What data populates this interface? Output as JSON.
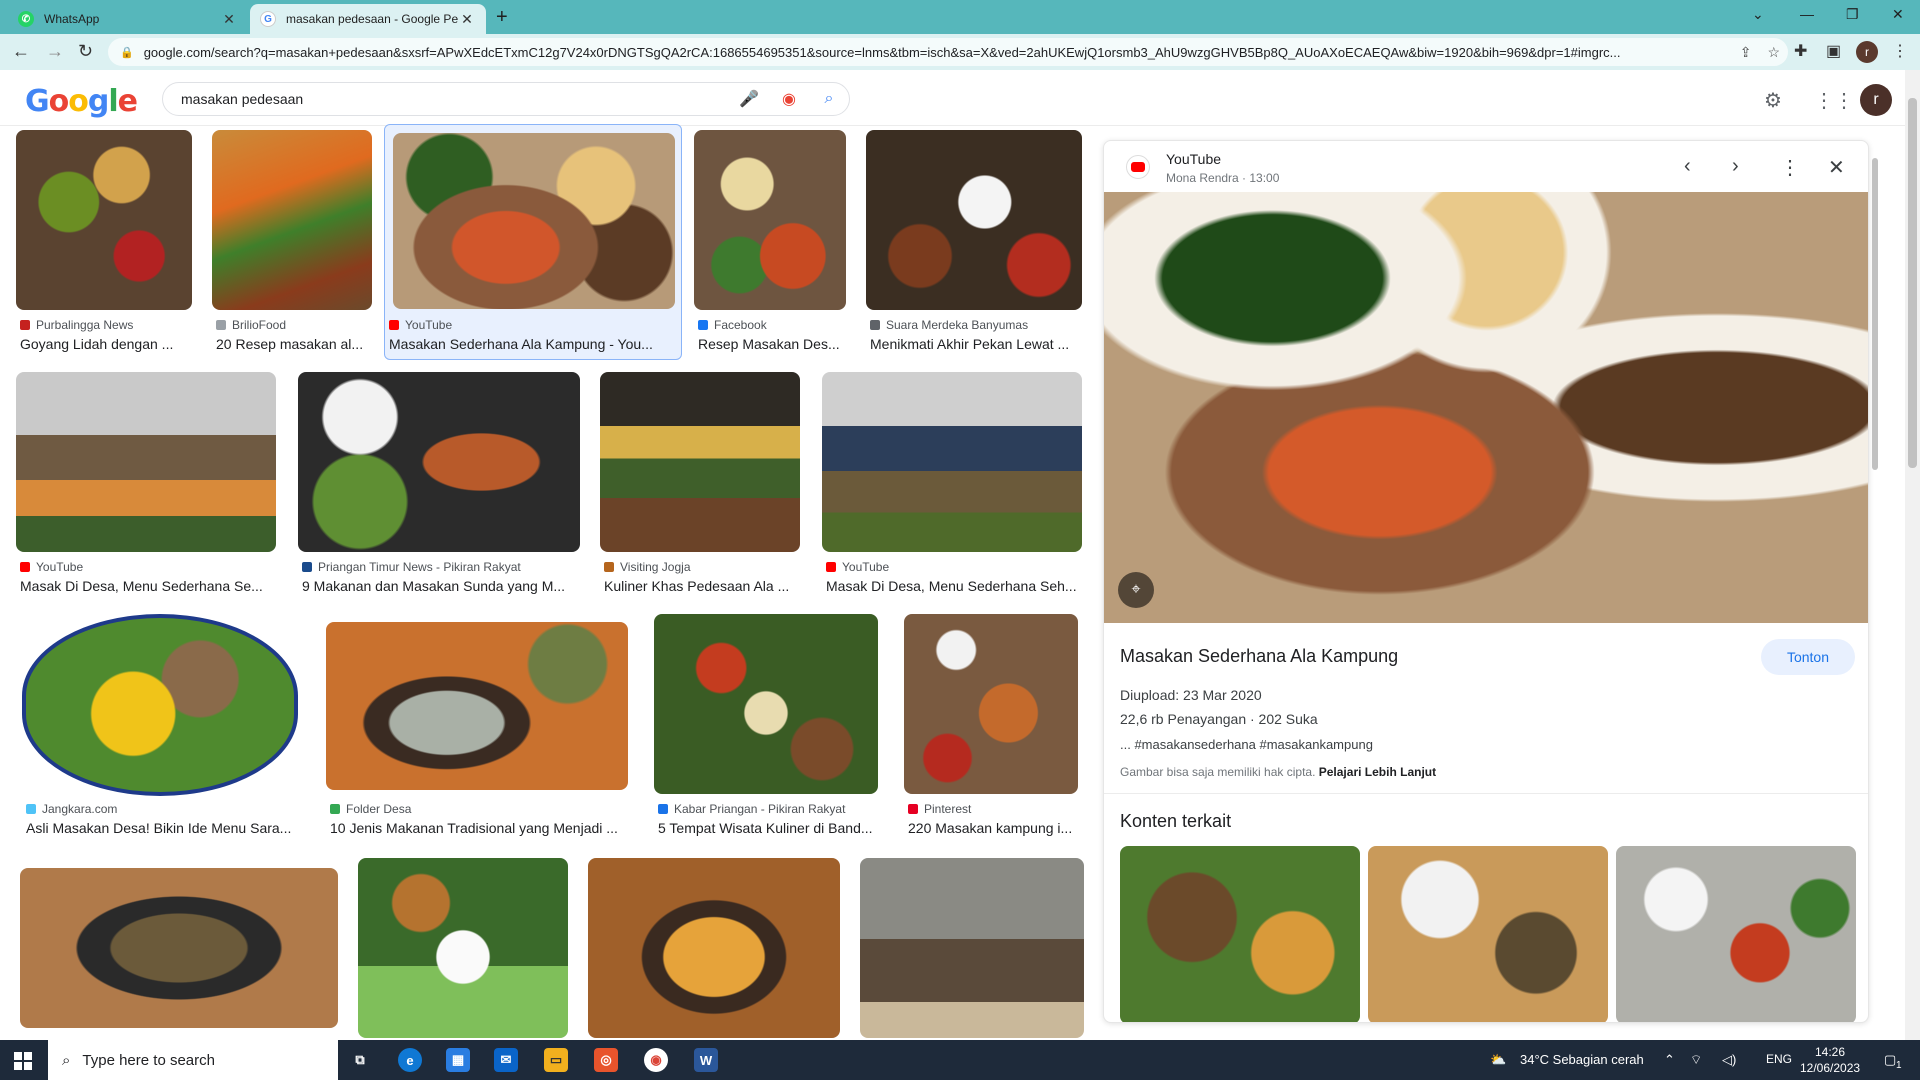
{
  "browser": {
    "tabs": [
      {
        "title": "WhatsApp",
        "icon": "whatsapp-icon",
        "active": false
      },
      {
        "title": "masakan pedesaan - Google Pen",
        "icon": "google-icon",
        "active": true
      }
    ],
    "url": "google.com/search?q=masakan+pedesaan&sxsrf=APwXEdcETxmC12g7V24x0rDNGTSgQA2rCA:1686554695351&source=lnms&tbm=isch&sa=X&ved=2ahUKEwjQ1orsmb3_AhU9wzgGHVB5Bp8Q_AUoAXoECAEQAw&biw=1920&bih=969&dpr=1#imgrc...",
    "profile_initial": "r"
  },
  "google": {
    "logo": "Google",
    "query": "masakan pedesaan",
    "avatar_initial": "r"
  },
  "results": [
    {
      "source": "Purbalingga News",
      "title": "Goyang Lidah dengan ...",
      "src_color": "#c5221f"
    },
    {
      "source": "BrilioFood",
      "title": "20 Resep masakan al...",
      "src_color": "#9aa0a6"
    },
    {
      "source": "YouTube",
      "title": "Masakan Sederhana Ala Kampung - You...",
      "src_color": "#ff0000"
    },
    {
      "source": "Facebook",
      "title": "Resep Masakan Des...",
      "src_color": "#1877f2"
    },
    {
      "source": "Suara Merdeka Banyumas",
      "title": "Menikmati Akhir Pekan Lewat ...",
      "src_color": "#5f6368"
    },
    {
      "source": "YouTube",
      "title": "Masak Di Desa, Menu Sederhana Se...",
      "src_color": "#ff0000"
    },
    {
      "source": "Priangan Timur News - Pikiran Rakyat",
      "title": "9 Makanan dan Masakan Sunda yang M...",
      "src_color": "#1a4b8c"
    },
    {
      "source": "Visiting Jogja",
      "title": "Kuliner Khas Pedesaan Ala ...",
      "src_color": "#b5651d"
    },
    {
      "source": "YouTube",
      "title": "Masak Di Desa, Menu Sederhana Seh...",
      "src_color": "#ff0000"
    },
    {
      "source": "Jangkara.com",
      "title": "Asli Masakan Desa! Bikin Ide Menu Sara...",
      "src_color": "#4fc3f7"
    },
    {
      "source": "Folder Desa",
      "title": "10 Jenis Makanan Tradisional yang Menjadi ...",
      "src_color": "#34a853"
    },
    {
      "source": "Kabar Priangan - Pikiran Rakyat",
      "title": "5 Tempat Wisata Kuliner di Band...",
      "src_color": "#1a73e8"
    },
    {
      "source": "Pinterest",
      "title": "220 Masakan kampung i...",
      "src_color": "#e60023"
    }
  ],
  "preview": {
    "source": "YouTube",
    "channel_meta": "Mona Rendra · 13:00",
    "title": "Masakan Sederhana Ala Kampung",
    "watch_label": "Tonton",
    "uploaded": "Diupload: 23 Mar 2020",
    "stats": "22,6 rb Penayangan · 202 Suka",
    "tags": "... #masakansederhana #masakankampung",
    "copyright": "Gambar bisa saja memiliki hak cipta.",
    "learn_more": "Pelajari Lebih Lanjut",
    "related_heading": "Konten terkait"
  },
  "taskbar": {
    "search_placeholder": "Type here to search",
    "weather": "34°C  Sebagian cerah",
    "language": "ENG",
    "time": "14:26",
    "date": "12/06/2023",
    "notification_count": "1"
  }
}
